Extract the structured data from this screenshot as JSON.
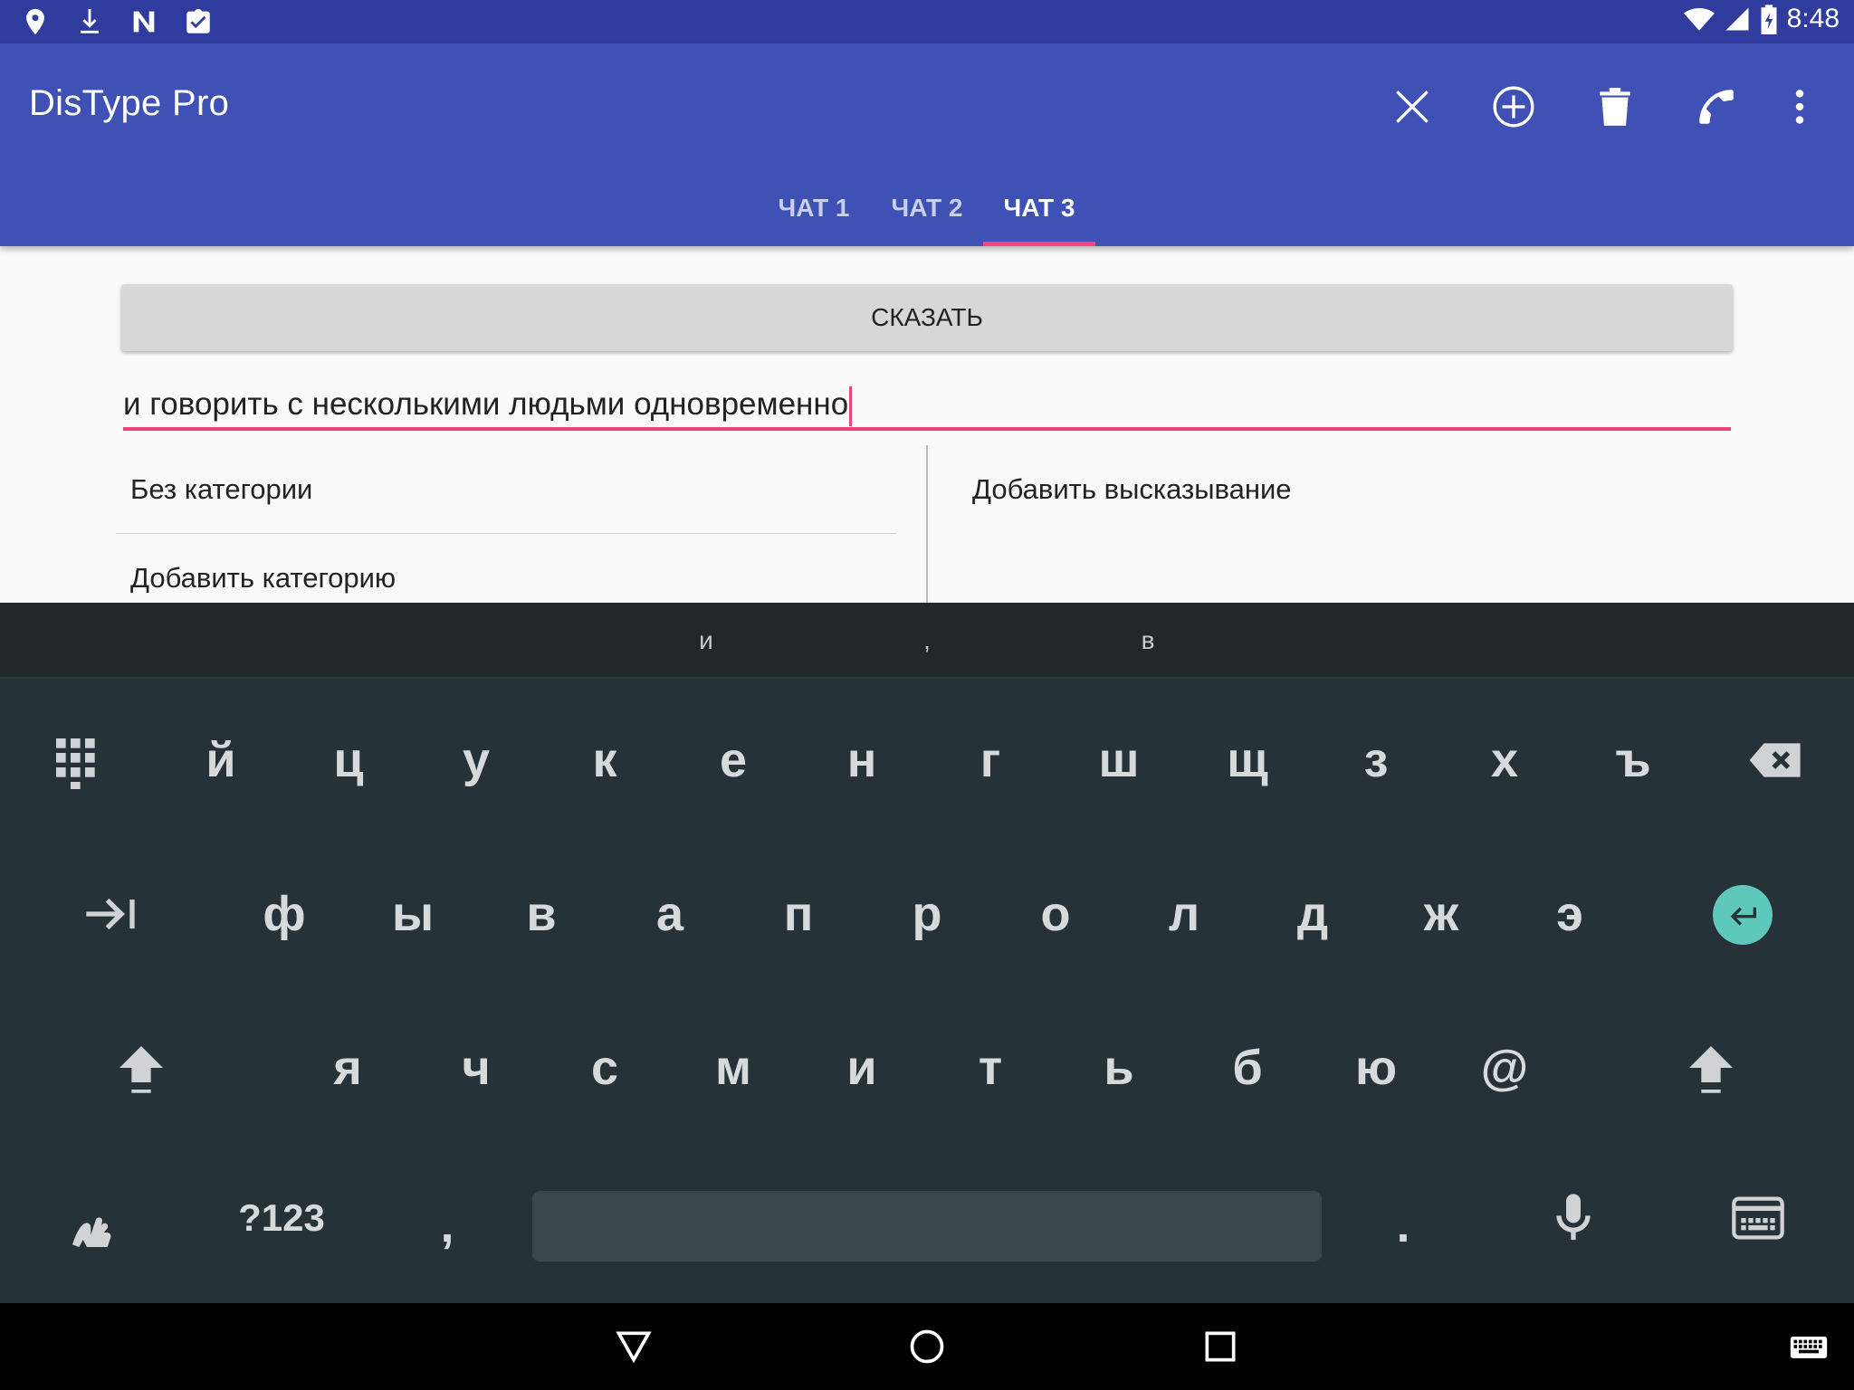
{
  "status_bar": {
    "time": "8:48",
    "left_icons": [
      "location-pin-icon",
      "download-icon",
      "n-badge-icon",
      "clipboard-check-icon"
    ],
    "right_icons": [
      "wifi-icon",
      "signal-icon",
      "battery-charging-icon"
    ]
  },
  "app_bar": {
    "title": "DisType Pro",
    "actions": [
      "close-icon",
      "add-circle-icon",
      "trash-icon",
      "phone-icon",
      "more-vert-icon"
    ]
  },
  "tabs": [
    {
      "label": "ЧАТ 1",
      "active": false
    },
    {
      "label": "ЧАТ 2",
      "active": false
    },
    {
      "label": "ЧАТ 3",
      "active": true
    }
  ],
  "say_button": {
    "label": "СКАЗАТЬ"
  },
  "utterance": {
    "value": "и говорить с несколькими людьми одновременно"
  },
  "categories": [
    {
      "label": "Без категории"
    },
    {
      "label": "Добавить категорию"
    }
  ],
  "phrases": [
    {
      "label": "Добавить высказывание"
    }
  ],
  "keyboard": {
    "suggestions": [
      "и",
      ",",
      "в"
    ],
    "row1": [
      "й",
      "ц",
      "у",
      "к",
      "е",
      "н",
      "г",
      "ш",
      "щ",
      "з",
      "х",
      "ъ"
    ],
    "row2": [
      "ф",
      "ы",
      "в",
      "а",
      "п",
      "р",
      "о",
      "л",
      "д",
      "ж",
      "э"
    ],
    "row3": [
      "я",
      "ч",
      "с",
      "м",
      "и",
      "т",
      "ь",
      "б",
      "ю",
      "@"
    ],
    "symbols_label": "?123",
    "comma": ",",
    "period": "."
  },
  "colors": {
    "status_bar": "#2f3c9d",
    "app_bar": "#3f51b5",
    "accent": "#ff4081",
    "keyboard_bg": "#263238",
    "enter_key": "#5ec8bc"
  }
}
